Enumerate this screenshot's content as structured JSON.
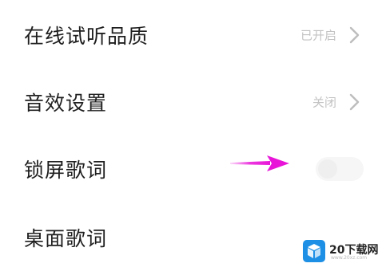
{
  "settings": {
    "items": [
      {
        "label": "在线试听品质",
        "value": "已开启",
        "control": "chevron"
      },
      {
        "label": "音效设置",
        "value": "关闭",
        "control": "chevron"
      },
      {
        "label": "锁屏歌词",
        "value": "",
        "control": "toggle",
        "toggle_on": false
      },
      {
        "label": "桌面歌词",
        "value": "",
        "control": "toggle",
        "toggle_on": false
      }
    ]
  },
  "annotation": {
    "arrow_color": "#e815d8",
    "arrow_icon": "magenta-arrow-icon"
  },
  "watermark": {
    "brand": "20下载网",
    "url": "www.20xz.com",
    "icon": "cube-logo-icon",
    "icon_color": "#1d8fe5"
  },
  "colors": {
    "label": "#1f1f1f",
    "value": "#c2c2c2",
    "chevron": "#bdbdbd",
    "toggle_off": "#f6f6f6"
  }
}
